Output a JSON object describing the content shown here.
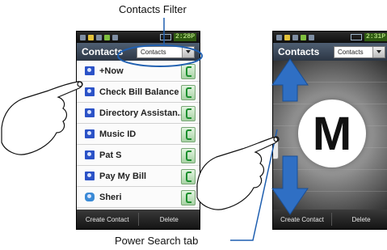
{
  "callouts": {
    "contacts_filter": "Contacts Filter",
    "power_search_tab": "Power Search tab"
  },
  "left_phone": {
    "status": {
      "time": "2:28P"
    },
    "title": "Contacts",
    "filter_value": "Contacts",
    "contacts": [
      {
        "name": "+Now",
        "icon": "contact-card-icon"
      },
      {
        "name": "Check Bill Balance",
        "icon": "contact-card-icon"
      },
      {
        "name": "Directory Assistan...",
        "icon": "contact-card-icon"
      },
      {
        "name": "Music ID",
        "icon": "contact-card-icon"
      },
      {
        "name": "Pat S",
        "icon": "contact-card-icon"
      },
      {
        "name": "Pay My Bill",
        "icon": "contact-card-icon"
      },
      {
        "name": "Sheri",
        "icon": "message-bubble-icon"
      }
    ],
    "softkeys": {
      "left": "Create Contact",
      "right": "Delete"
    }
  },
  "right_phone": {
    "status": {
      "time": "2:31P"
    },
    "title": "Contacts",
    "filter_value": "Contacts",
    "search_letter": "M",
    "softkeys": {
      "left": "Create Contact",
      "right": "Delete"
    }
  },
  "colors": {
    "callout_line": "#1f5fb0",
    "arrow_blue": "#2f6fc4",
    "title_bar": "#3d4a5b",
    "call_green": "#1b8f2e"
  }
}
